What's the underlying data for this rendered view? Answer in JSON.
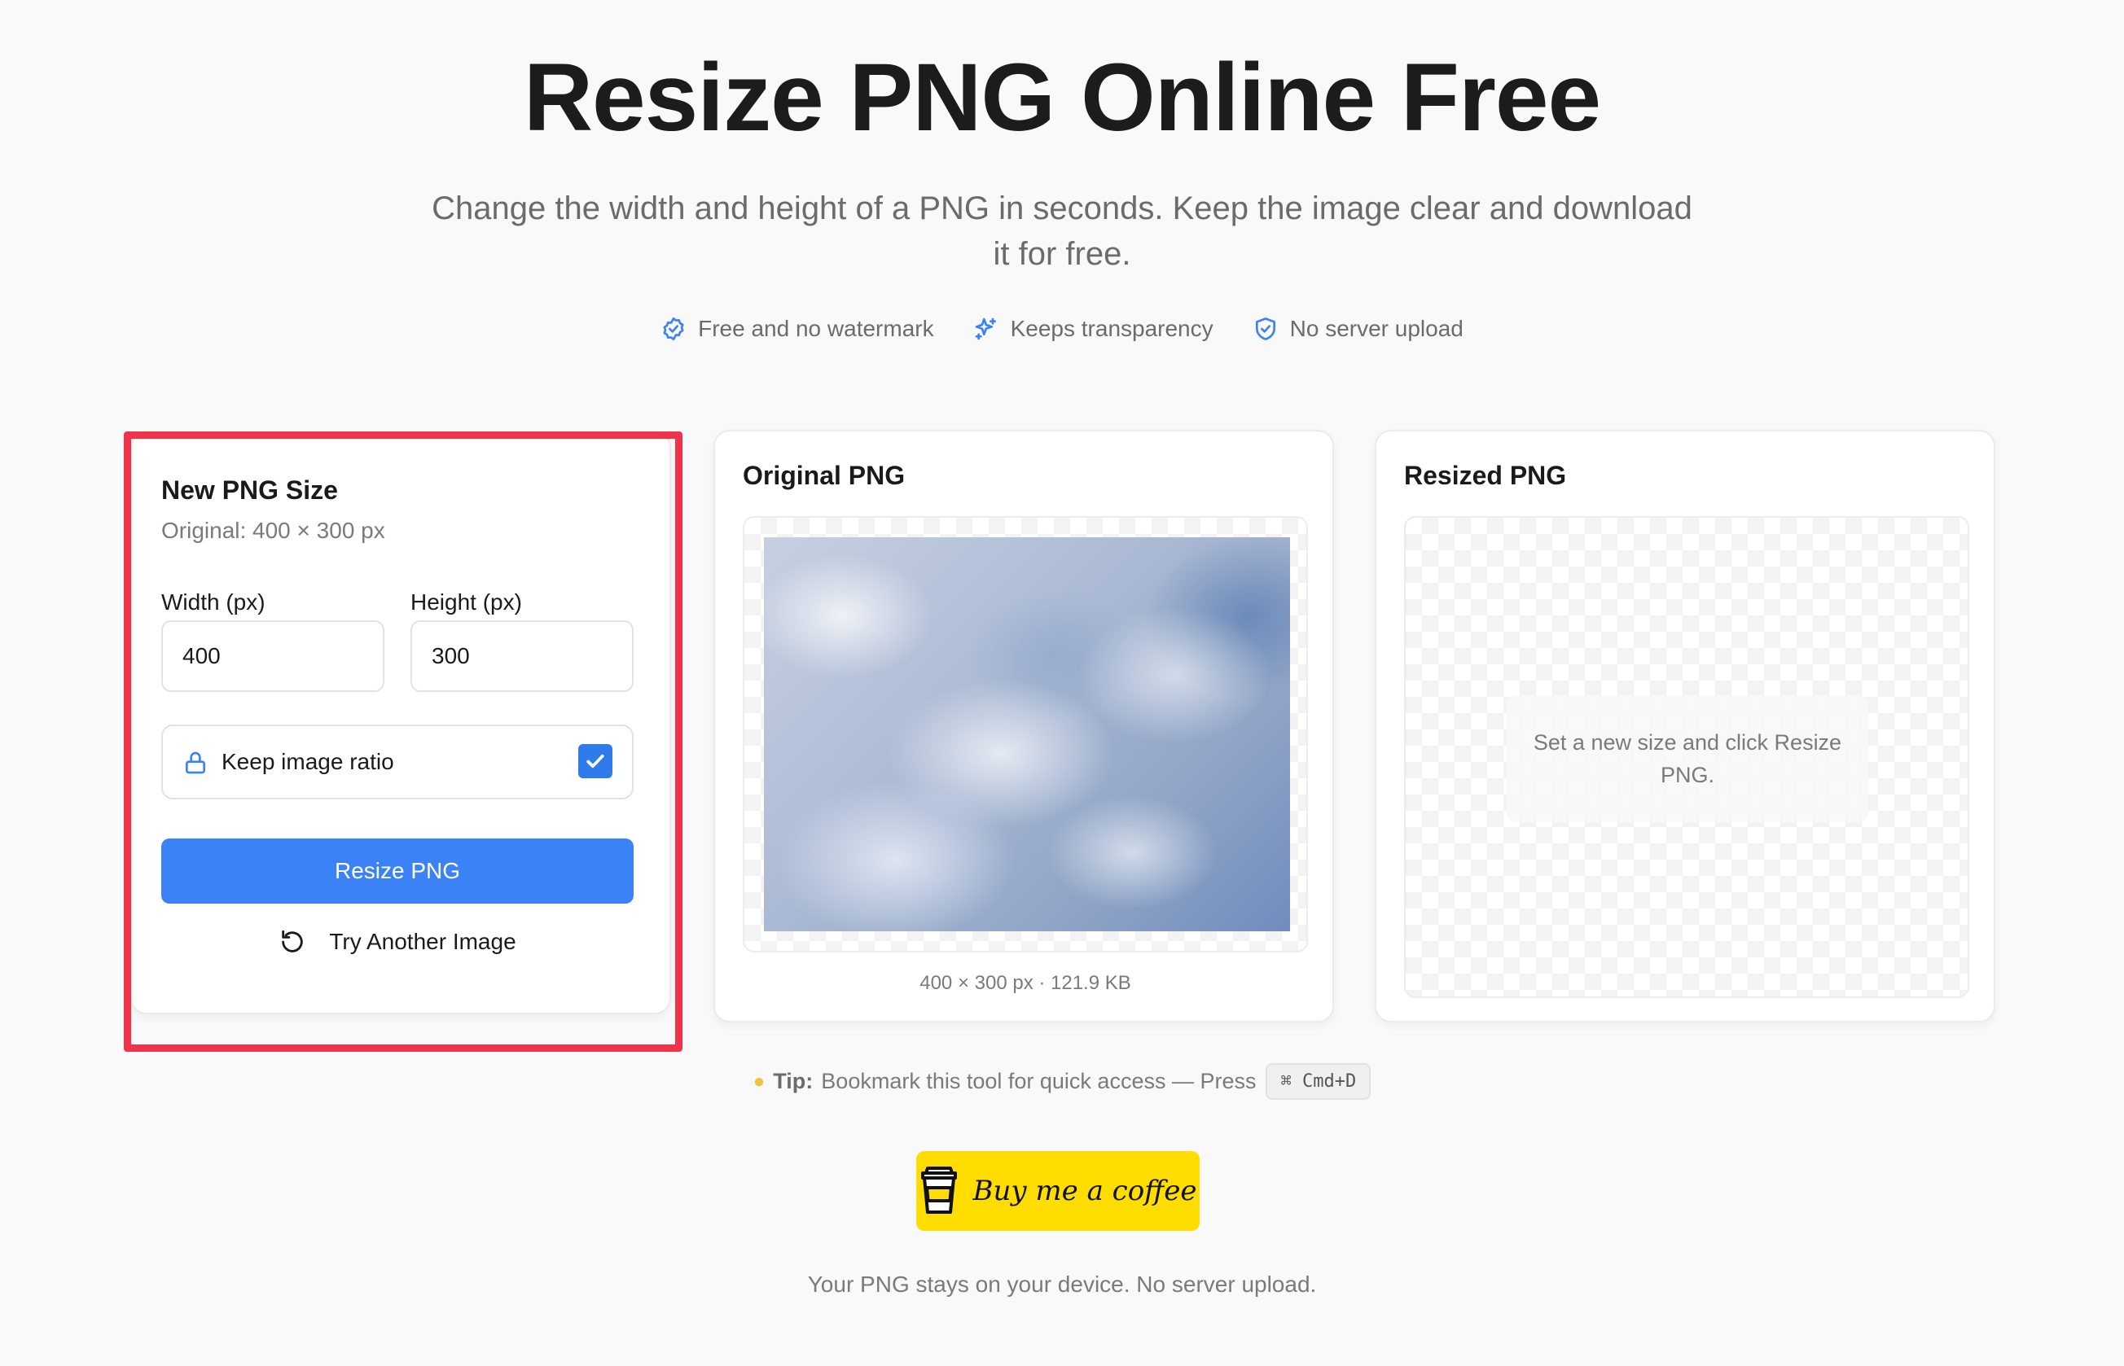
{
  "hero": {
    "title": "Resize PNG Online Free",
    "subtitle": "Change the width and height of a PNG in seconds. Keep the image clear and download it for free."
  },
  "features": [
    {
      "label": "Free and no watermark",
      "icon": "check-badge-icon"
    },
    {
      "label": "Keeps transparency",
      "icon": "sparkles-icon"
    },
    {
      "label": "No server upload",
      "icon": "shield-check-icon"
    }
  ],
  "settings": {
    "title": "New PNG Size",
    "original": "Original: 400 × 300 px",
    "width_label": "Width (px)",
    "width_value": "400",
    "height_label": "Height (px)",
    "height_value": "300",
    "keep_ratio_label": "Keep image ratio",
    "keep_ratio_checked": true,
    "resize_button": "Resize PNG",
    "try_another": "Try Another Image"
  },
  "original_panel": {
    "title": "Original PNG",
    "meta": "400 × 300 px · 121.9 KB"
  },
  "resized_panel": {
    "title": "Resized PNG",
    "placeholder": "Set a new size and click Resize PNG."
  },
  "tip": {
    "label": "Tip:",
    "text": "Bookmark this tool for quick access — Press",
    "shortcut": "⌘ Cmd+D"
  },
  "coffee_label": "Buy me a coffee",
  "footer_note": "Your PNG stays on your device. No server upload.",
  "colors": {
    "accent": "#3b82f6",
    "highlight": "#f0324a",
    "coffee": "#ffdd00"
  }
}
